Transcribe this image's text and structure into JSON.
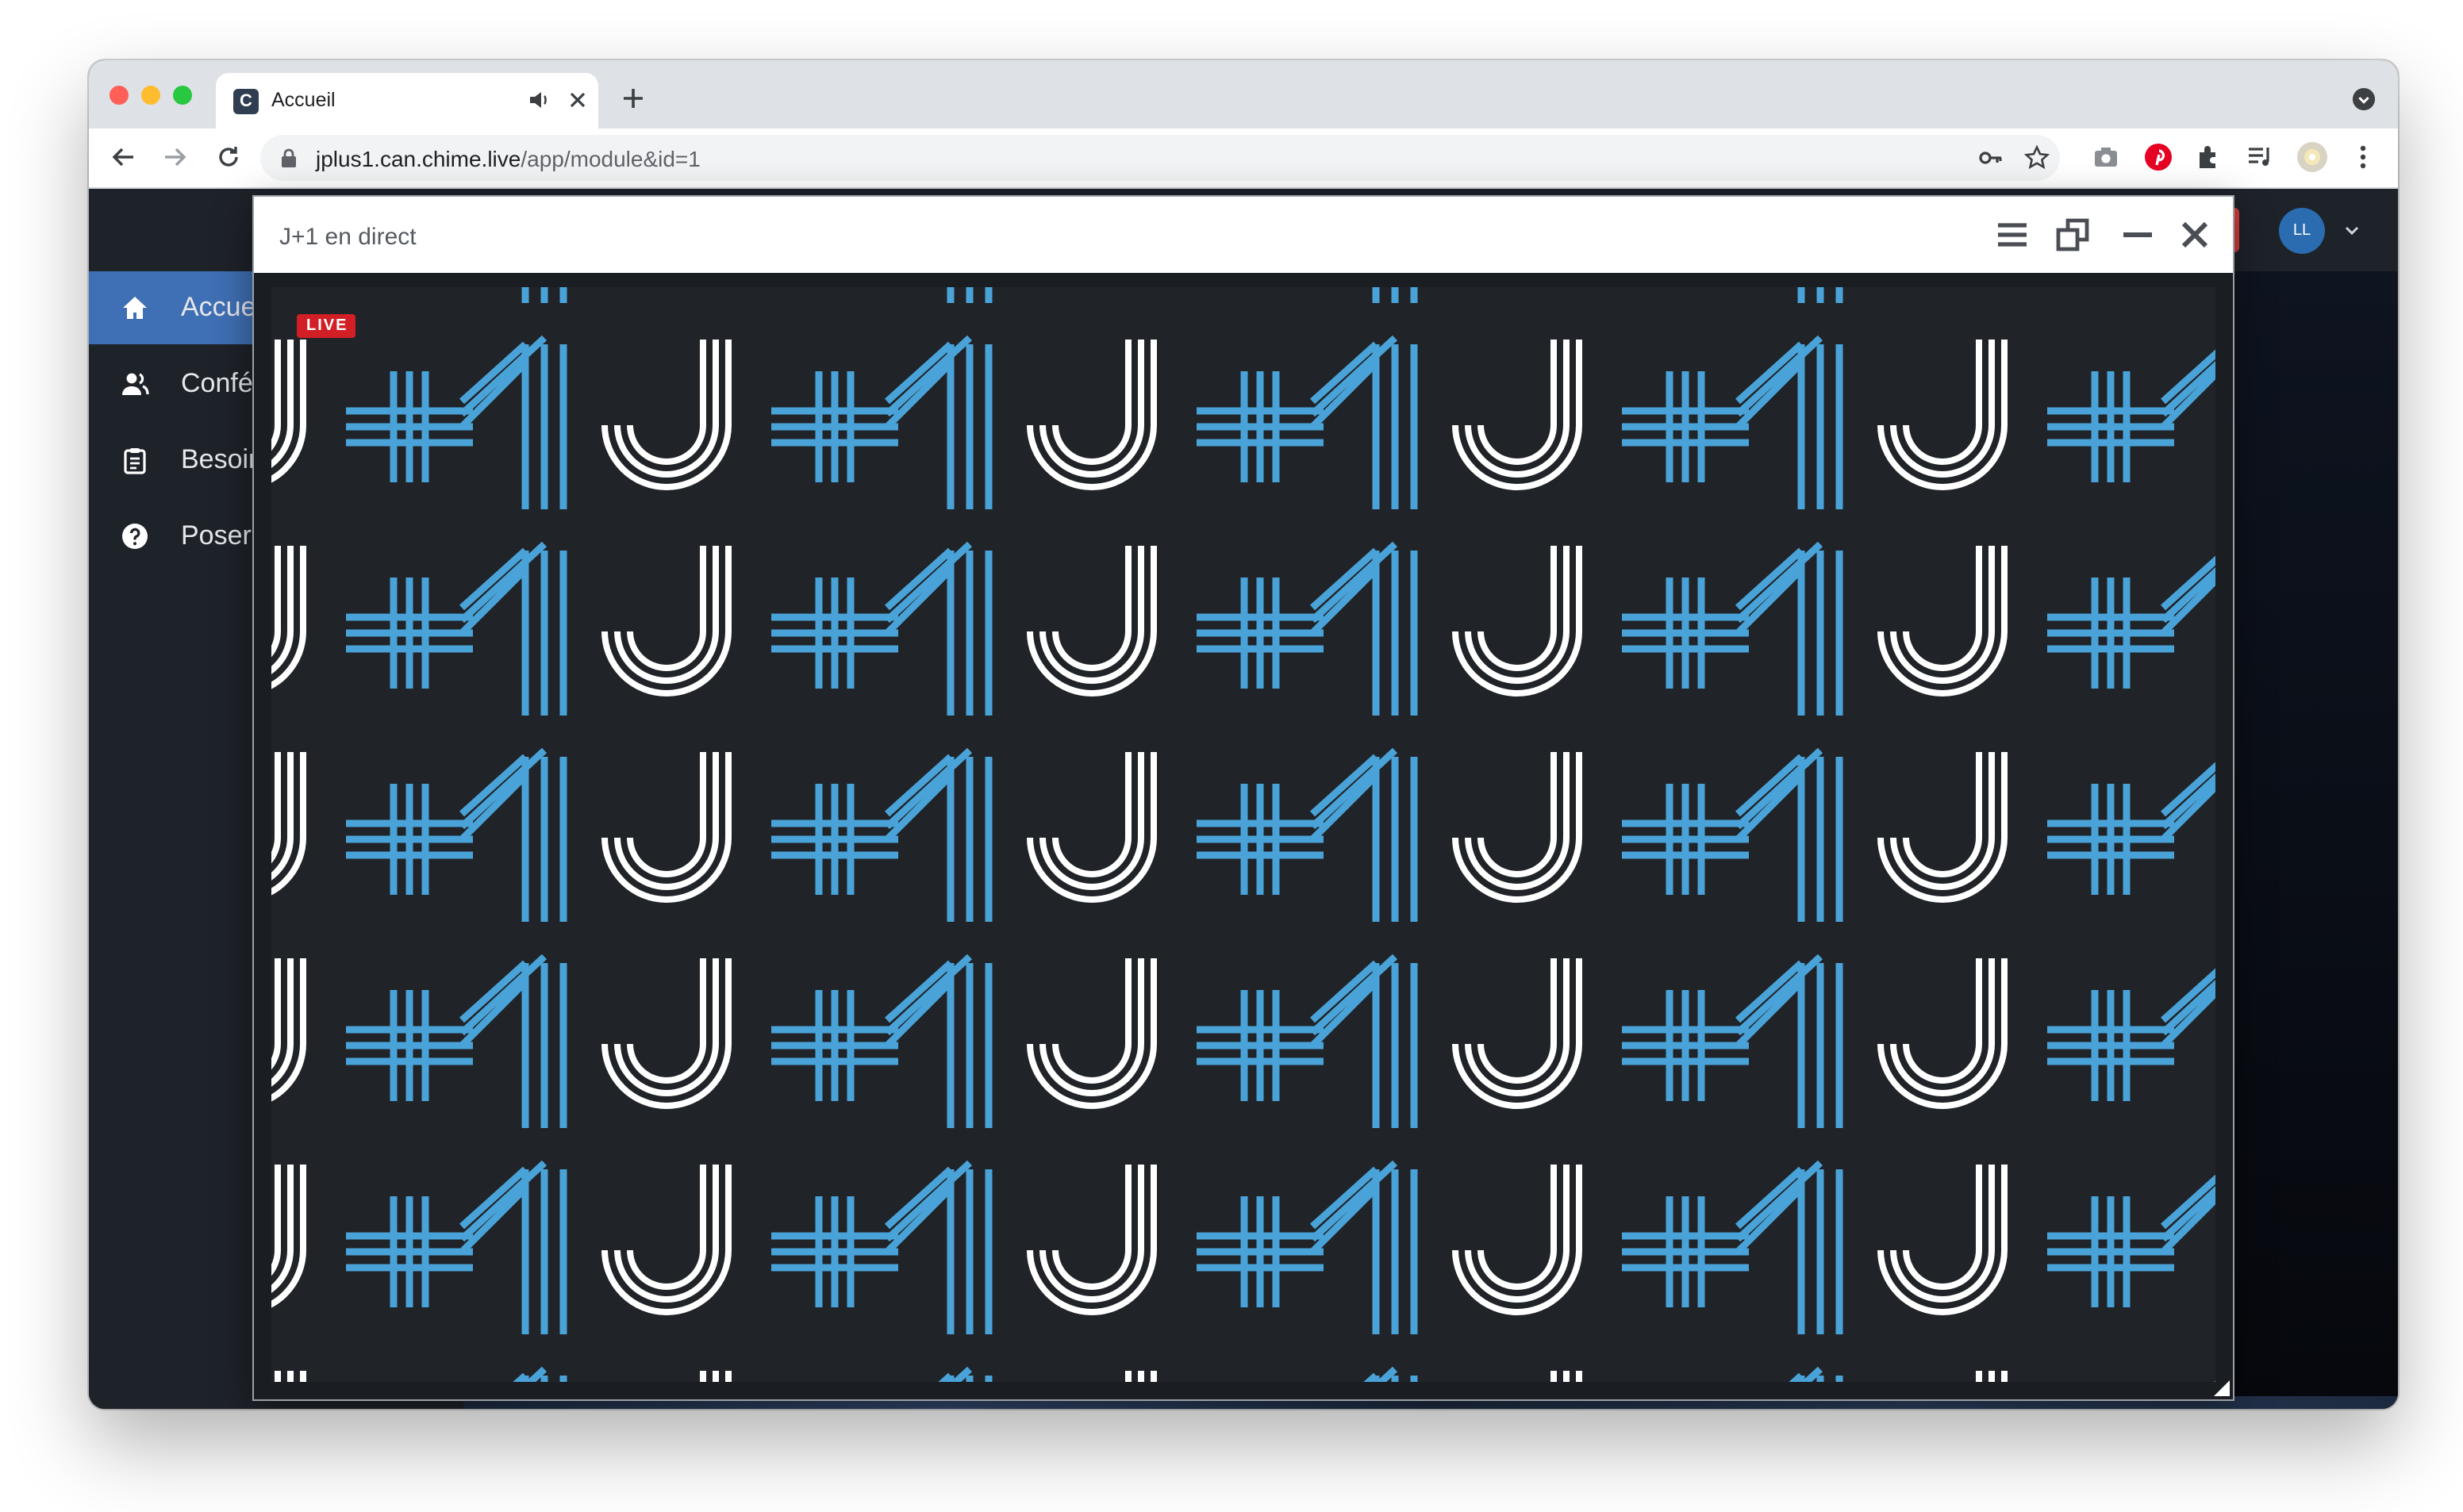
{
  "browser": {
    "tab_title": "Accueil",
    "favicon_letter": "C",
    "url_host": "jplus1.can.chime.live",
    "url_path": "/app/module&id=1"
  },
  "sidebar": {
    "items": [
      {
        "label": "Accueil",
        "icon": "home-icon",
        "active": true
      },
      {
        "label": "Conférences",
        "icon": "users-icon",
        "active": false
      },
      {
        "label": "Besoins",
        "icon": "clipboard-icon",
        "active": false
      },
      {
        "label": "Poser une question",
        "icon": "question-icon",
        "active": false
      }
    ]
  },
  "user": {
    "initials": "LL"
  },
  "player": {
    "title": "J+1 en direct",
    "live_badge": "LIVE"
  },
  "colors": {
    "accent": "#3f6fb4",
    "pattern_blue": "#4aa3d8",
    "pattern_white": "#ffffff",
    "live_red": "#d21f26"
  }
}
